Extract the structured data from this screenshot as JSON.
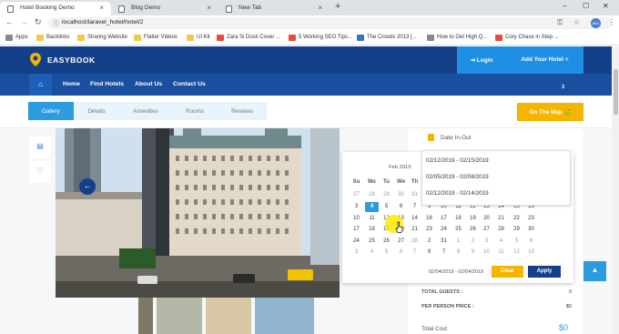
{
  "browser": {
    "tabs": [
      {
        "title": "Hotel Booking Demo",
        "active": true
      },
      {
        "title": "Blog Demo",
        "active": false
      },
      {
        "title": "New Tab",
        "active": false
      }
    ],
    "new_tab": "+",
    "window_controls": [
      "–",
      "☐",
      "✕"
    ],
    "url": "localhost/laravel_hotel/hotel/2",
    "profile_text": "ABC",
    "bookmarks": [
      {
        "label": "Apps",
        "icon": "apps-grid-icon"
      },
      {
        "label": "Backlinks",
        "icon": "folder-icon"
      },
      {
        "label": "Sharing Website",
        "icon": "folder-icon"
      },
      {
        "label": "Flatter Videos",
        "icon": "folder-icon"
      },
      {
        "label": "UI Kit",
        "icon": "folder-icon"
      },
      {
        "label": "Zara Si Dosti Cover ...",
        "icon": "youtube-icon"
      },
      {
        "label": "5 Working SEO Tips...",
        "icon": "youtube-icon"
      },
      {
        "label": "The Croods 2013 [...",
        "icon": "site-icon"
      },
      {
        "label": "How to Get High Q...",
        "icon": "page-icon"
      },
      {
        "label": "Cory Chase in Step ...",
        "icon": "site-icon"
      }
    ]
  },
  "site": {
    "brand": "EASYBOOK",
    "login": "Login",
    "add_hotel": "Add Your Hotel",
    "nav": [
      "Home",
      "Find Hotels",
      "About Us",
      "Contact Us"
    ],
    "cart_count": "3",
    "subtabs": [
      "Gallery",
      "Details",
      "Amenities",
      "Rooms",
      "Reviews"
    ],
    "on_map": "On The Map"
  },
  "booking": {
    "date_label": "Date In-Out",
    "ranges": [
      "02/12/2019 - 02/15/2019",
      "02/05/2019 - 02/08/2019",
      "02/12/2019 - 02/14/2019"
    ],
    "total_guests_label": "TOTAL GUESTS :",
    "total_guests_value": "0",
    "per_person_label": "PER PERSON PRICE :",
    "per_person_value": "$0",
    "total_cost_label": "Total Cost",
    "total_cost_value": "$0"
  },
  "calendar": {
    "month": "Feb 2019",
    "dow": [
      "Su",
      "Mo",
      "Tu",
      "We",
      "Th"
    ],
    "left_weeks": [
      [
        "27",
        "28",
        "29",
        "30",
        "31"
      ],
      [
        "3",
        "4",
        "5",
        "6",
        "7"
      ],
      [
        "10",
        "11",
        "12",
        "13",
        "14"
      ],
      [
        "17",
        "18",
        "19",
        "20",
        "21"
      ],
      [
        "24",
        "25",
        "26",
        "27",
        "28"
      ],
      [
        "3",
        "4",
        "5",
        "6",
        "7"
      ]
    ],
    "right_weeks": [
      [
        "2"
      ],
      [
        "9",
        "10",
        "11",
        "12",
        "13",
        "14",
        "15",
        "16"
      ],
      [
        "16",
        "17",
        "18",
        "19",
        "20",
        "21",
        "22",
        "23"
      ],
      [
        "23",
        "24",
        "25",
        "26",
        "27",
        "28",
        "29",
        "30"
      ],
      [
        "2",
        "31",
        "1",
        "2",
        "3",
        "4",
        "5",
        "6"
      ],
      [
        "9",
        "7",
        "8",
        "9",
        "10",
        "11",
        "12",
        "13"
      ]
    ],
    "selected": "4",
    "range_text": "02/04/2019 - 02/04/2019",
    "clear": "Clear",
    "apply": "Apply"
  }
}
